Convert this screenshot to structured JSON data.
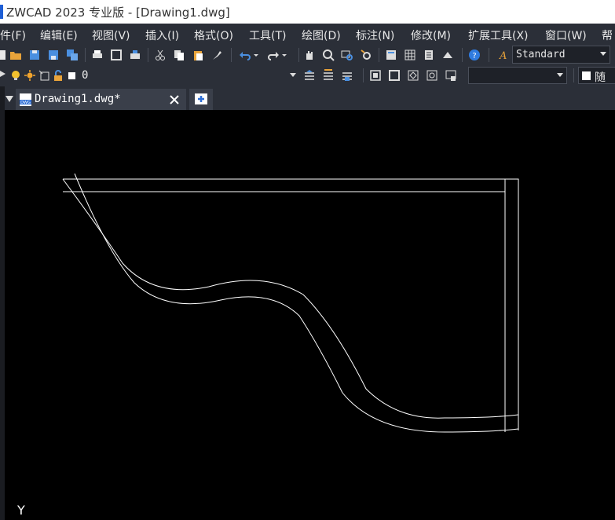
{
  "window": {
    "title": "ZWCAD 2023 专业版 - [Drawing1.dwg]"
  },
  "menu": {
    "items": [
      {
        "label": "件(F)"
      },
      {
        "label": "编辑(E)"
      },
      {
        "label": "视图(V)"
      },
      {
        "label": "插入(I)"
      },
      {
        "label": "格式(O)"
      },
      {
        "label": "工具(T)"
      },
      {
        "label": "绘图(D)"
      },
      {
        "label": "标注(N)"
      },
      {
        "label": "修改(M)"
      },
      {
        "label": "扩展工具(X)"
      },
      {
        "label": "窗口(W)"
      },
      {
        "label": "帮"
      }
    ]
  },
  "toolbar": {
    "text_style_value": "Standard",
    "layer_value": "0",
    "linetype_value": "",
    "color_label": "随层"
  },
  "tabs": {
    "active_label": "Drawing1.dwg*",
    "dwg_badge": "DWG"
  },
  "canvas": {
    "background": "#000000",
    "stroke": "#ffffff",
    "ucs_label": "Y"
  }
}
